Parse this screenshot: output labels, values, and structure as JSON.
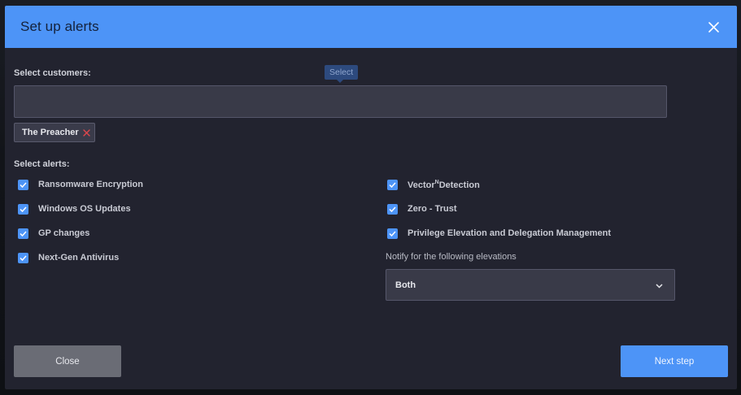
{
  "modal": {
    "title": "Set up alerts",
    "close_icon": "close-icon"
  },
  "customers": {
    "label": "Select customers:",
    "tooltip": "Select",
    "input_value": "",
    "chips": [
      {
        "label": "The Preacher",
        "remove_icon": "close-icon"
      }
    ]
  },
  "alerts": {
    "label": "Select alerts:",
    "left": [
      {
        "label": "Ransomware Encryption",
        "checked": true
      },
      {
        "label": "Windows OS Updates",
        "checked": true
      },
      {
        "label": "GP changes",
        "checked": true
      },
      {
        "label": "Next-Gen Antivirus",
        "checked": true
      }
    ],
    "right": [
      {
        "label_pre": "Vector",
        "label_sup": "N",
        "label_post": "Detection",
        "checked": true
      },
      {
        "label": "Zero - Trust",
        "checked": true
      },
      {
        "label": "Privilege Elevation and Delegation Management",
        "checked": true
      }
    ]
  },
  "elevations": {
    "label": "Notify for the following elevations",
    "selected": "Both",
    "icon": "chevron-down-icon"
  },
  "footer": {
    "close_label": "Close",
    "next_label": "Next step"
  },
  "colors": {
    "accent": "#4d94f7",
    "modal_bg": "#22232f",
    "remove_red": "#e0474c"
  }
}
